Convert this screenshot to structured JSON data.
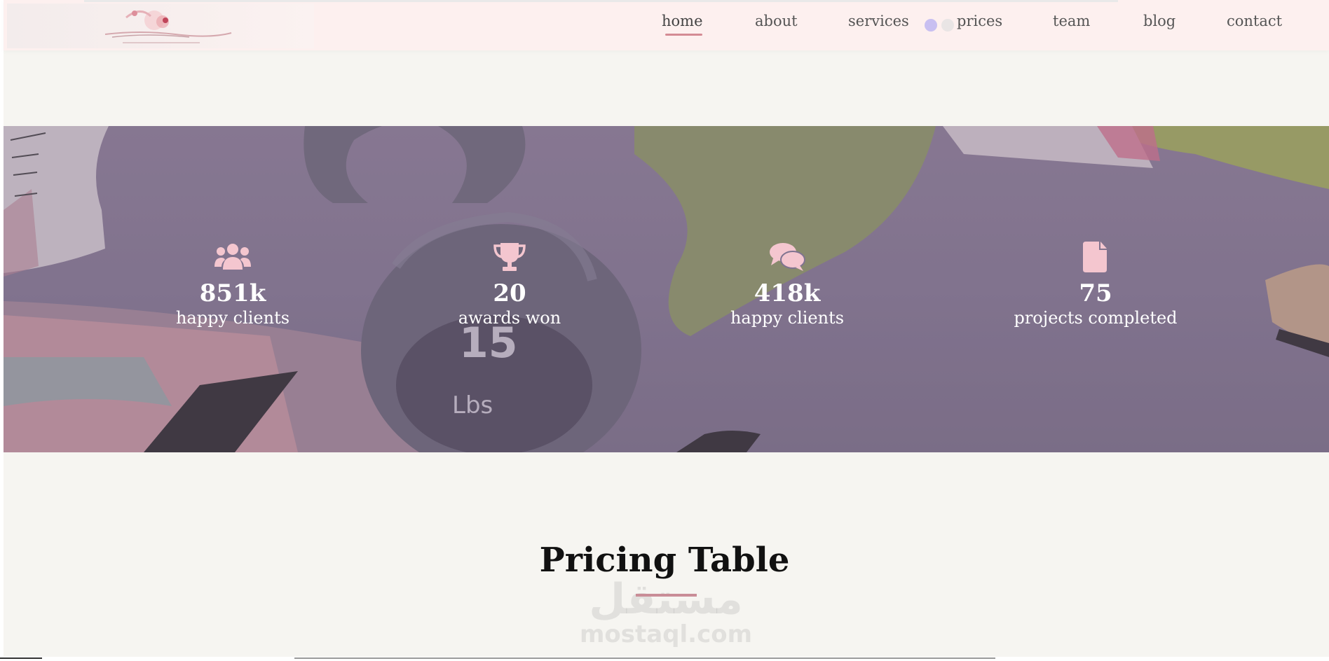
{
  "nav": {
    "items": [
      {
        "label": "home",
        "active": true
      },
      {
        "label": "about"
      },
      {
        "label": "services"
      },
      {
        "label": "prices"
      },
      {
        "label": "team"
      },
      {
        "label": "blog"
      },
      {
        "label": "contact"
      }
    ],
    "accent": "#d48b94"
  },
  "stats": [
    {
      "icon": "users-icon",
      "value": "851k",
      "label": "happy clients"
    },
    {
      "icon": "trophy-icon",
      "value": "20",
      "label": "awards won"
    },
    {
      "icon": "comments-icon",
      "value": "418k",
      "label": "happy clients"
    },
    {
      "icon": "file-icon",
      "value": "75",
      "label": "projects completed"
    }
  ],
  "stat_icon_color": "#f4c6cf",
  "section": {
    "title": "Pricing Table",
    "underline_color": "#c98d97"
  },
  "watermark": {
    "arabic": "مستقل",
    "latin": "mostaql.com"
  }
}
